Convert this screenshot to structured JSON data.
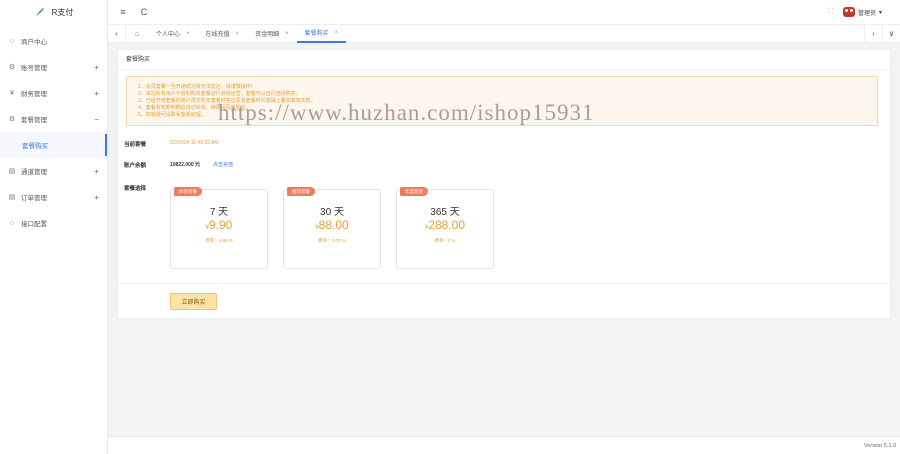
{
  "app": {
    "name": "R支付"
  },
  "sidebar": {
    "items": [
      {
        "label": "商户中心",
        "icon": "circle-icon",
        "expandable": false
      },
      {
        "label": "账号管理",
        "icon": "gear-icon",
        "expandable": true,
        "toggle": "+"
      },
      {
        "label": "财务管理",
        "icon": "yen-icon",
        "expandable": true,
        "toggle": "+"
      },
      {
        "label": "套餐管理",
        "icon": "gear-icon",
        "expandable": true,
        "toggle": "−"
      },
      {
        "label": "套餐购买",
        "sub": true
      },
      {
        "label": "通道管理",
        "icon": "list-icon",
        "expandable": true,
        "toggle": "+"
      },
      {
        "label": "订单管理",
        "icon": "list-icon",
        "expandable": true,
        "toggle": "+"
      },
      {
        "label": "接口配置",
        "icon": "circle-icon",
        "expandable": false
      }
    ]
  },
  "header": {
    "user": "管理员",
    "dropdown_symbol": "▾",
    "refresh_symbol": "C",
    "menu_symbol": "≡",
    "expand_symbol": "⛶"
  },
  "tabs": [
    {
      "label": "个人中心",
      "close": "×"
    },
    {
      "label": "在线充值",
      "close": "×"
    },
    {
      "label": "资金明细",
      "close": "×"
    },
    {
      "label": "套餐购买",
      "close": "×",
      "active": true
    }
  ],
  "tab_nav": {
    "prev": "‹",
    "next": "›",
    "more": "∨",
    "home": "⌂"
  },
  "panel": {
    "title": "套餐购买",
    "notice": [
      "1、会员套餐一旦开通成功将无法退还，请谨慎操作!",
      "2、本站所有用户不强制购买套餐进行通道运营，套餐可以自行选择购买。",
      "3、已经开通套餐的用户再次购买套餐时将在原有套餐时间基础上叠加有效天数。",
      "4、套餐有效期到期后自动失效，续费请及时购买。",
      "5、如有疑问请联系客服处理。"
    ],
    "current_label": "当前套餐",
    "current_value": "6/3/2024 11:40:33 AM",
    "balance_label": "账户余额",
    "balance_value": "10822.000 元",
    "recharge_link": "点击充值",
    "choose_label": "套餐选择",
    "packages": [
      {
        "badge": "体验套餐",
        "days": "7 天",
        "currency": "¥",
        "price": "9.90",
        "rate": "费率：4.85 %"
      },
      {
        "badge": "推荐套餐",
        "days": "30 天",
        "currency": "¥",
        "price": "88.00",
        "rate": "费率：0.00 %"
      },
      {
        "badge": "年度套餐",
        "days": "365 天",
        "currency": "¥",
        "price": "288.00",
        "rate": "费率：0 %"
      }
    ],
    "buy_button": "立即购买"
  },
  "watermark": "https://www.huzhan.com/ishop15931",
  "footer": {
    "version": "Version 5.1.0"
  },
  "colors": {
    "accent": "#3a7ae0",
    "warning": "#e6a23c",
    "badge": "#f37b5d"
  }
}
